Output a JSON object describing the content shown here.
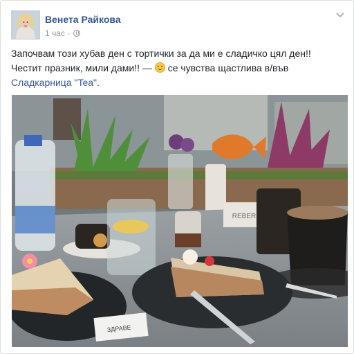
{
  "post": {
    "author": "Венета Райкова",
    "time": "1 час",
    "dot": "·",
    "text_before": "Започвам този хубав ден с тортички за да ми е сладичко цял ден!! Честит празник, мили дами!! — ",
    "feeling": "се чувства щастлива в/във",
    "place": "Сладкарница \"Tea\"",
    "text_after": "."
  },
  "photo": {
    "napkin_text": "ЗДРАВЕ",
    "sign_text": "REBER"
  },
  "icons": {
    "avatar": "profile-photo",
    "privacy": "globe-icon",
    "options": "chevron-down-icon",
    "feeling": "smiley-emoji-icon"
  }
}
